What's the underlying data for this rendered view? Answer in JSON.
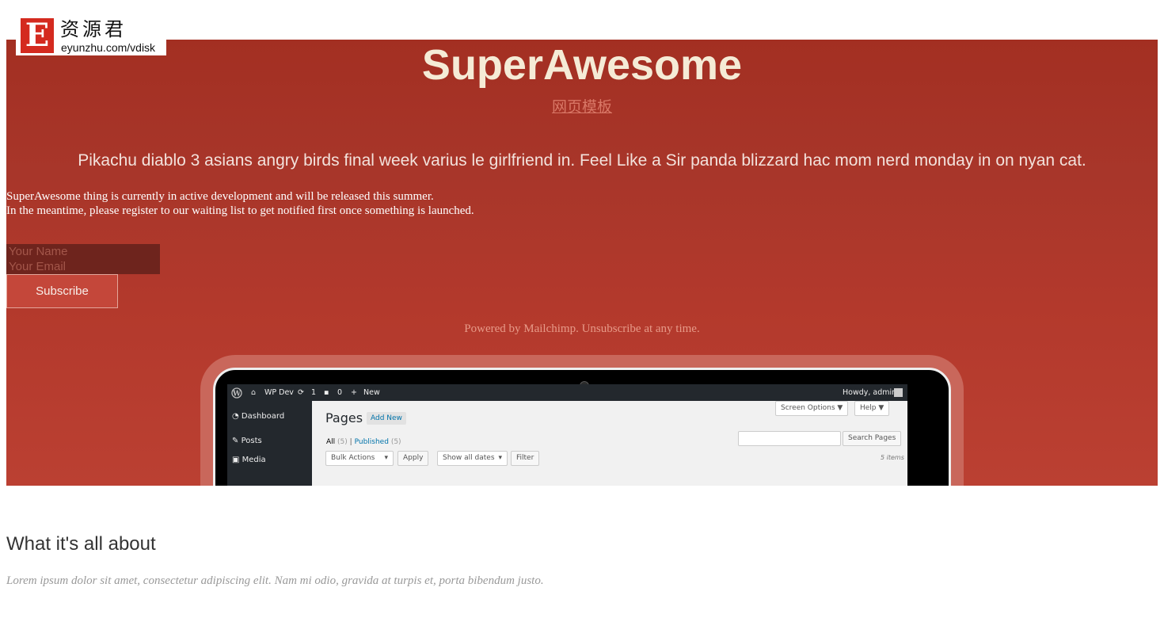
{
  "watermark": {
    "badge_letter": "E",
    "cn_text": "资源君",
    "url": "eyunzhu.com/vdisk"
  },
  "hero": {
    "title": "SuperAwesome",
    "sublink": "网页模板",
    "lead": "Pikachu diablo 3 asians angry birds final week varius le girlfriend in. Feel Like a Sir panda blizzard hac mom nerd monday in on nyan cat.",
    "desc_line1": "SuperAwesome thing is currently in active development and will be released this summer.",
    "desc_line2": "In the meantime, please register to our waiting list to get notified first once something is launched.",
    "form": {
      "name_placeholder": "Your Name",
      "email_placeholder": "Your Email",
      "subscribe_label": "Subscribe"
    },
    "powered_text": "Powered by Mailchimp. Unsubscribe at any time."
  },
  "wp": {
    "site_name": "WP Dev",
    "updates_count": "1",
    "comments_count": "0",
    "new_label": "New",
    "howdy": "Howdy, admin",
    "menu": [
      "Dashboard",
      "Posts",
      "Media"
    ],
    "page_title": "Pages",
    "add_new": "Add New",
    "screen_options": "Screen Options ▼",
    "help": "Help ▼",
    "filter_all": "All",
    "filter_all_count": "(5)",
    "filter_sep": "|",
    "filter_published": "Published",
    "filter_published_count": "(5)",
    "search_button": "Search Pages",
    "bulk_actions": "Bulk Actions",
    "apply": "Apply",
    "show_all_dates": "Show all dates",
    "filter_button": "Filter",
    "items_count": "5 items"
  },
  "about": {
    "title": "What it's all about",
    "text": "Lorem ipsum dolor sit amet, consectetur adipiscing elit. Nam mi odio, gravida at turpis et, porta bibendum justo."
  },
  "colors": {
    "hero_red": "#b3392c",
    "title_cream": "#f5ebd6",
    "wp_dark": "#23282d"
  }
}
